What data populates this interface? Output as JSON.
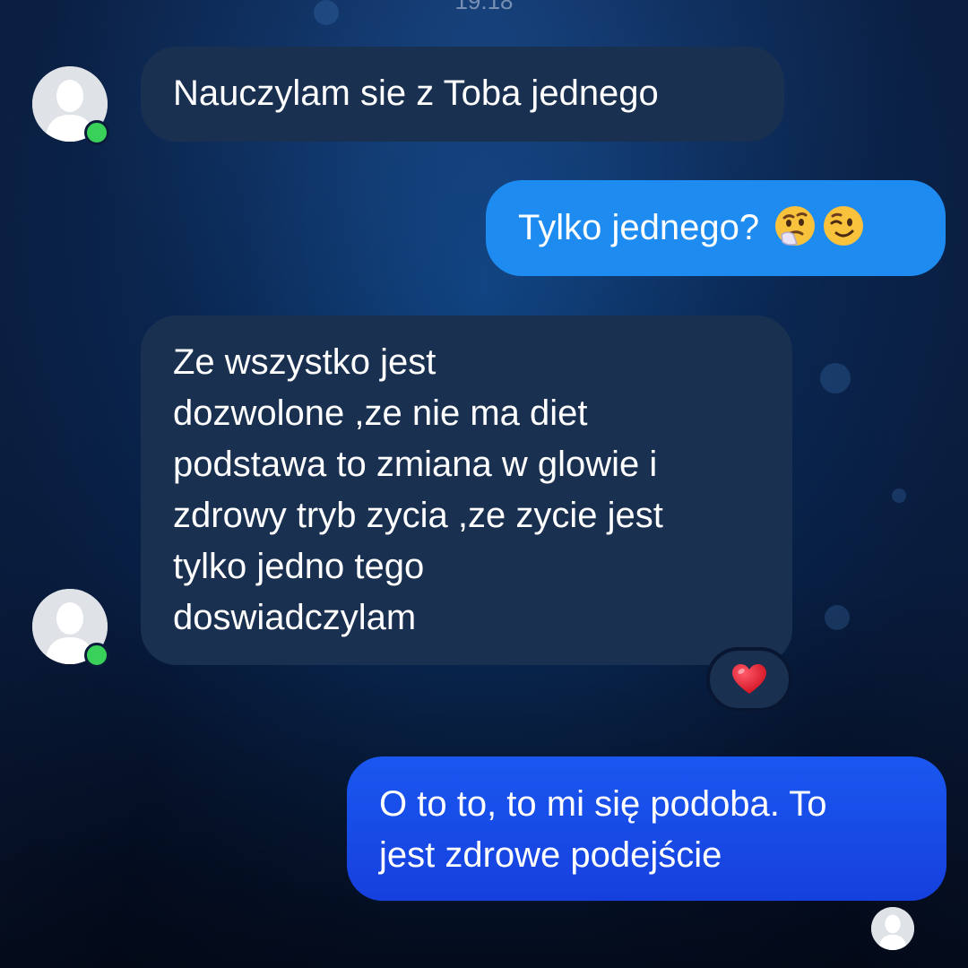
{
  "chat": {
    "timestamp": "19:18",
    "messages": [
      {
        "direction": "incoming",
        "text": "Nauczylam sie z Toba jednego"
      },
      {
        "direction": "outgoing",
        "text": "Tylko jednego?",
        "emojis": [
          "thinking-face-icon",
          "winking-face-icon"
        ]
      },
      {
        "direction": "incoming",
        "text": "Ze wszystko jest\ndozwolone ,ze nie ma diet\npodstawa to zmiana w glowie i\nzdrowy tryb zycia ,ze zycie jest\ntylko jedno tego\ndoswiadczylam",
        "reaction": "red-heart-icon"
      },
      {
        "direction": "outgoing",
        "text": "O to to, to mi się podoba. To\njest zdrowe podejście"
      }
    ]
  },
  "colors": {
    "incoming_bubble": "#1a3050",
    "outgoing_bubble_light": "#1e8ff0",
    "outgoing_bubble_deep": "#1746e6",
    "online_indicator": "#3ad15b",
    "heart": "#e0182d"
  }
}
